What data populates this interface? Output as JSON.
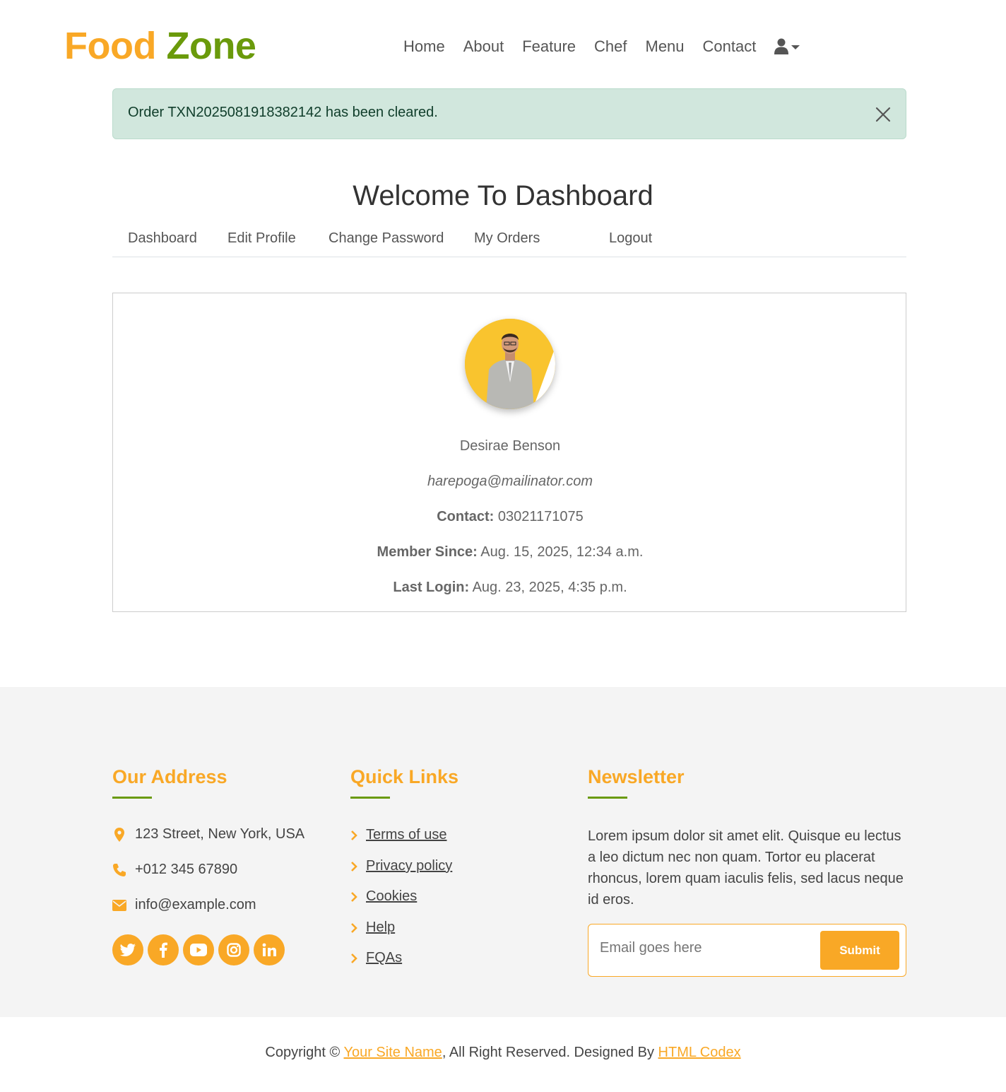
{
  "brand": {
    "word1": "Food",
    "word2": "Zone"
  },
  "nav": {
    "items": [
      "Home",
      "About",
      "Feature",
      "Chef",
      "Menu",
      "Contact"
    ]
  },
  "alert": {
    "message": "Order TXN2025081918382142 has been cleared."
  },
  "dashboard": {
    "title": "Welcome To Dashboard",
    "tabs": [
      "Dashboard",
      "Edit Profile",
      "Change Password",
      "My Orders",
      "Logout"
    ]
  },
  "profile": {
    "name": "Desirae Benson",
    "email": "harepoga@mailinator.com",
    "contact_label": "Contact:",
    "contact": "03021171075",
    "member_since_label": "Member Since:",
    "member_since": "Aug. 15, 2025, 12:34 a.m.",
    "last_login_label": "Last Login:",
    "last_login": "Aug. 23, 2025, 4:35 p.m."
  },
  "footer": {
    "address_title": "Our Address",
    "address": "123 Street, New York, USA",
    "phone": "+012 345 67890",
    "email": "info@example.com",
    "socials": [
      "twitter-icon",
      "facebook-icon",
      "youtube-icon",
      "instagram-icon",
      "linkedin-icon"
    ],
    "links_title": "Quick Links",
    "links": [
      "Terms of use",
      "Privacy policy",
      "Cookies",
      "Help",
      "FQAs"
    ],
    "newsletter_title": "Newsletter",
    "newsletter_text": "Lorem ipsum dolor sit amet elit. Quisque eu lectus a leo dictum nec non quam. Tortor eu placerat rhoncus, lorem quam iaculis felis, sed lacus neque id eros.",
    "newsletter_placeholder": "Email goes here",
    "newsletter_button": "Submit"
  },
  "copyright": {
    "prefix": "Copyright ©",
    "site_name": "Your Site Name",
    "middle": ", All Right Reserved. Designed By",
    "designer": "HTML Codex"
  },
  "colors": {
    "primary": "#f9a826",
    "secondary": "#6a9a0b",
    "alert_bg": "#d1e7dd"
  }
}
